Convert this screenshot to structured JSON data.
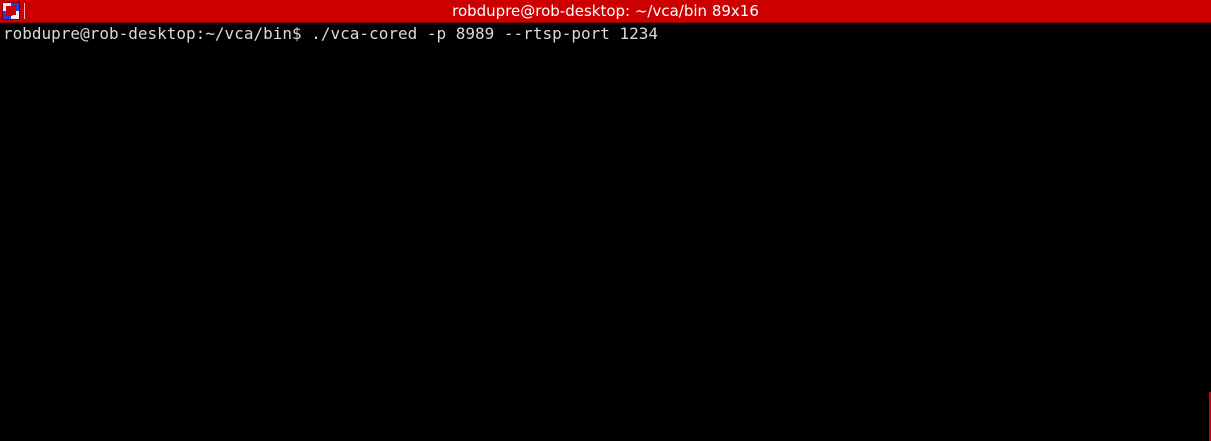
{
  "window": {
    "title": "robdupre@rob-desktop: ~/vca/bin 89x16",
    "titlebar_color": "#cc0000",
    "background_color": "#000000",
    "icon": "terminal-app-icon"
  },
  "terminal": {
    "prompt": "robdupre@rob-desktop:~/vca/bin$",
    "command": " ./vca-cored -p 8989 --rtsp-port 1234",
    "text_color": "#d9d9d9"
  }
}
